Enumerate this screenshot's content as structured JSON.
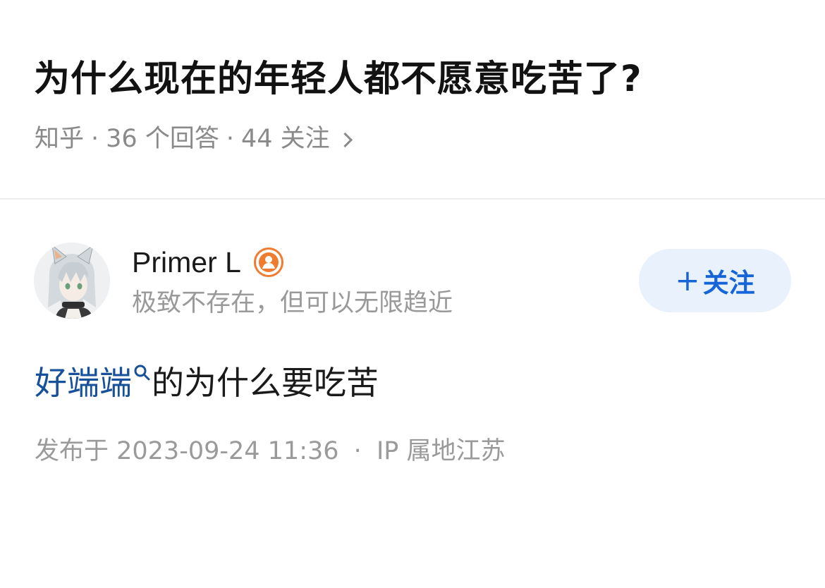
{
  "question": {
    "title": "为什么现在的年轻人都不愿意吃苦了?",
    "source": "知乎",
    "answers_count": "36 个回答",
    "followers_count": "44 关注",
    "separator": "·"
  },
  "author": {
    "name": "Primer L",
    "bio": "极致不存在，但可以无限趋近",
    "avatar_icon": "avatar-anime-girl",
    "badge_icon": "user-badge-icon",
    "badge_color": "#f07c30"
  },
  "follow_button": {
    "plus": "+",
    "label": "关注",
    "text_color": "#1565d8",
    "bg_color": "#e9f1fd"
  },
  "answer": {
    "link_text": "好端端",
    "rest_text": "的为什么要吃苦",
    "link_color": "#175199"
  },
  "publish": {
    "label": "发布于 2023-09-24 11:36",
    "separator": "·",
    "ip": "IP 属地江苏"
  }
}
